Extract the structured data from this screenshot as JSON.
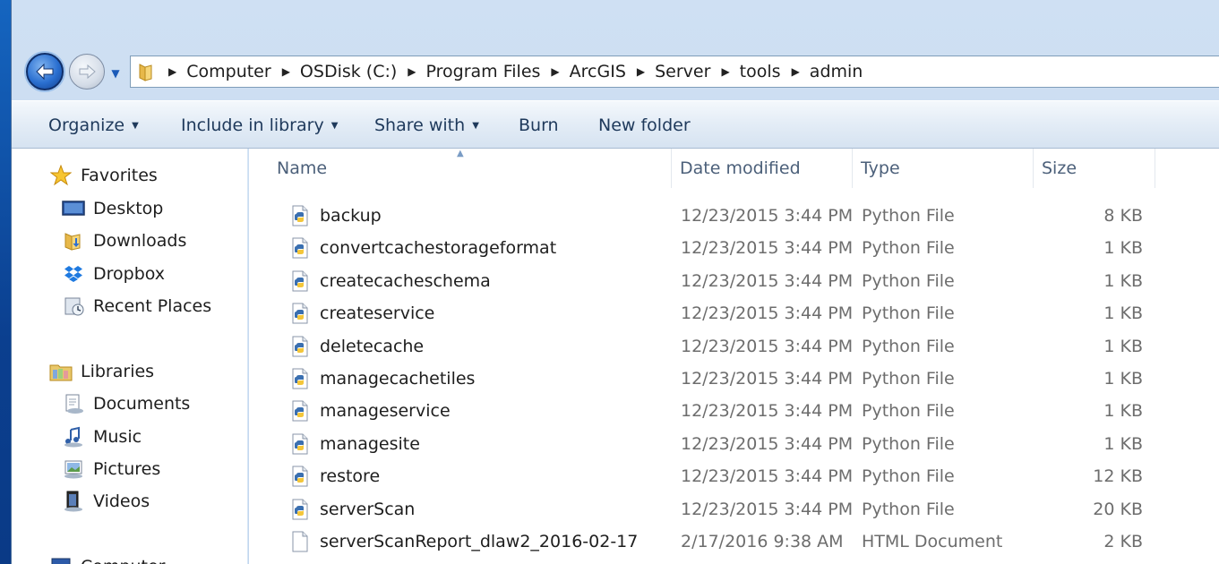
{
  "address": {
    "crumbs": [
      "Computer",
      "OSDisk (C:)",
      "Program Files",
      "ArcGIS",
      "Server",
      "tools",
      "admin"
    ]
  },
  "toolbar": {
    "organize": "Organize",
    "include_in_library": "Include in library",
    "share_with": "Share with",
    "burn": "Burn",
    "new_folder": "New folder"
  },
  "nav": {
    "favorites": "Favorites",
    "desktop": "Desktop",
    "downloads": "Downloads",
    "dropbox": "Dropbox",
    "recent_places": "Recent Places",
    "libraries": "Libraries",
    "documents": "Documents",
    "music": "Music",
    "pictures": "Pictures",
    "videos": "Videos",
    "computer": "Computer"
  },
  "columns": {
    "name": "Name",
    "date_modified": "Date modified",
    "type": "Type",
    "size": "Size"
  },
  "files": [
    {
      "name": "backup",
      "date": "12/23/2015 3:44 PM",
      "type": "Python File",
      "size": "8 KB",
      "icon": "python-file-icon"
    },
    {
      "name": "convertcachestorageformat",
      "date": "12/23/2015 3:44 PM",
      "type": "Python File",
      "size": "1 KB",
      "icon": "python-file-icon"
    },
    {
      "name": "createcacheschema",
      "date": "12/23/2015 3:44 PM",
      "type": "Python File",
      "size": "1 KB",
      "icon": "python-file-icon"
    },
    {
      "name": "createservice",
      "date": "12/23/2015 3:44 PM",
      "type": "Python File",
      "size": "1 KB",
      "icon": "python-file-icon"
    },
    {
      "name": "deletecache",
      "date": "12/23/2015 3:44 PM",
      "type": "Python File",
      "size": "1 KB",
      "icon": "python-file-icon"
    },
    {
      "name": "managecachetiles",
      "date": "12/23/2015 3:44 PM",
      "type": "Python File",
      "size": "1 KB",
      "icon": "python-file-icon"
    },
    {
      "name": "manageservice",
      "date": "12/23/2015 3:44 PM",
      "type": "Python File",
      "size": "1 KB",
      "icon": "python-file-icon"
    },
    {
      "name": "managesite",
      "date": "12/23/2015 3:44 PM",
      "type": "Python File",
      "size": "1 KB",
      "icon": "python-file-icon"
    },
    {
      "name": "restore",
      "date": "12/23/2015 3:44 PM",
      "type": "Python File",
      "size": "12 KB",
      "icon": "python-file-icon"
    },
    {
      "name": "serverScan",
      "date": "12/23/2015 3:44 PM",
      "type": "Python File",
      "size": "20 KB",
      "icon": "python-file-icon"
    },
    {
      "name": "serverScanReport_dlaw2_2016-02-17",
      "date": "2/17/2016 9:38 AM",
      "type": "HTML Document",
      "size": "2 KB",
      "icon": "html-document-icon"
    }
  ]
}
